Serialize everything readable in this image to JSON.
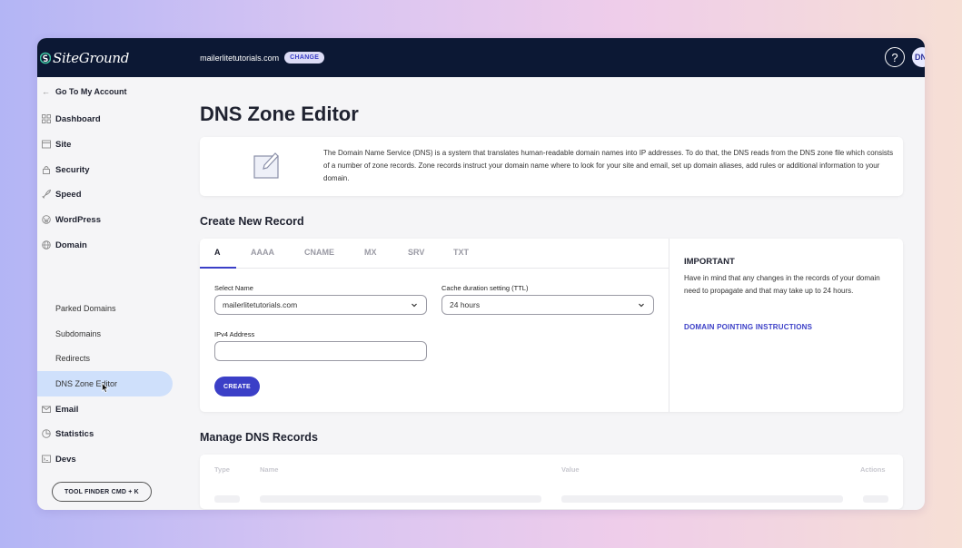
{
  "header": {
    "logo_text": "SiteGround",
    "domain": "mailerlitetutorials.com",
    "change_label": "CHANGE",
    "help_label": "?",
    "avatar_initials": "DN"
  },
  "sidebar": {
    "back_label": "Go To My Account",
    "items": [
      {
        "label": "Dashboard",
        "icon": "grid-icon"
      },
      {
        "label": "Site",
        "icon": "site-icon"
      },
      {
        "label": "Security",
        "icon": "lock-icon"
      },
      {
        "label": "Speed",
        "icon": "rocket-icon"
      },
      {
        "label": "WordPress",
        "icon": "wordpress-icon"
      },
      {
        "label": "Domain",
        "icon": "globe-icon"
      },
      {
        "label": "Email",
        "icon": "mail-icon"
      },
      {
        "label": "Statistics",
        "icon": "pie-chart-icon"
      },
      {
        "label": "Devs",
        "icon": "terminal-icon"
      }
    ],
    "domain_subitems": [
      "Parked Domains",
      "Subdomains",
      "Redirects",
      "DNS Zone Editor"
    ],
    "active_subitem": "DNS Zone Editor",
    "tool_finder_label": "TOOL FINDER CMD + K"
  },
  "main": {
    "title": "DNS Zone Editor",
    "info_text": "The Domain Name Service (DNS) is a system that translates human-readable domain names into IP addresses. To do that, the DNS reads from the DNS zone file which consists of a number of zone records. Zone records instruct your domain name where to look for your site and email, set up domain aliases, add rules or additional information to your domain.",
    "create_title": "Create New Record",
    "tabs": [
      "A",
      "AAAA",
      "CNAME",
      "MX",
      "SRV",
      "TXT"
    ],
    "active_tab": "A",
    "form": {
      "select_name_label": "Select Name",
      "select_name_value": "mailerlitetutorials.com",
      "ttl_label": "Cache duration setting (TTL)",
      "ttl_value": "24 hours",
      "ipv4_label": "IPv4 Address",
      "ipv4_value": "",
      "create_label": "CREATE"
    },
    "important": {
      "title": "IMPORTANT",
      "text": "Have in mind that any changes in the records of your domain need to propagate and that may take up to 24 hours.",
      "link": "DOMAIN POINTING INSTRUCTIONS"
    },
    "manage_title": "Manage DNS Records",
    "table_columns": [
      "Type",
      "Name",
      "Value",
      "Actions"
    ]
  },
  "colors": {
    "topbar": "#0c1834",
    "accent": "#3b3fc7",
    "active_bg": "#cfe0fb"
  }
}
